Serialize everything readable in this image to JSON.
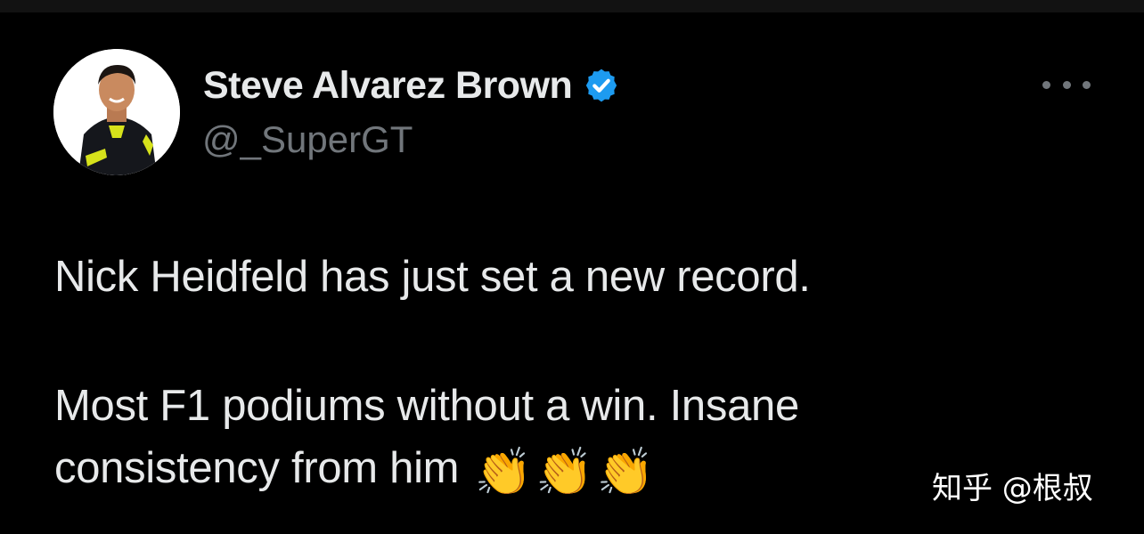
{
  "user": {
    "display_name": "Steve Alvarez Brown",
    "handle": "@_SuperGT",
    "verified": true,
    "verified_color": "#1d9bf0"
  },
  "menu": {
    "icon": "more-horizontal-icon"
  },
  "tweet": {
    "line1": "Nick Heidfeld has just set a new record.",
    "line2": "Most F1 podiums without a win. Insane",
    "line3": "consistency from him",
    "emoji": [
      "👏",
      "👏",
      "👏"
    ]
  },
  "watermark": {
    "text": "知乎 @根叔"
  },
  "colors": {
    "background": "#000000",
    "text_primary": "#e7e9ea",
    "text_secondary": "#71767b",
    "accent": "#1d9bf0"
  }
}
